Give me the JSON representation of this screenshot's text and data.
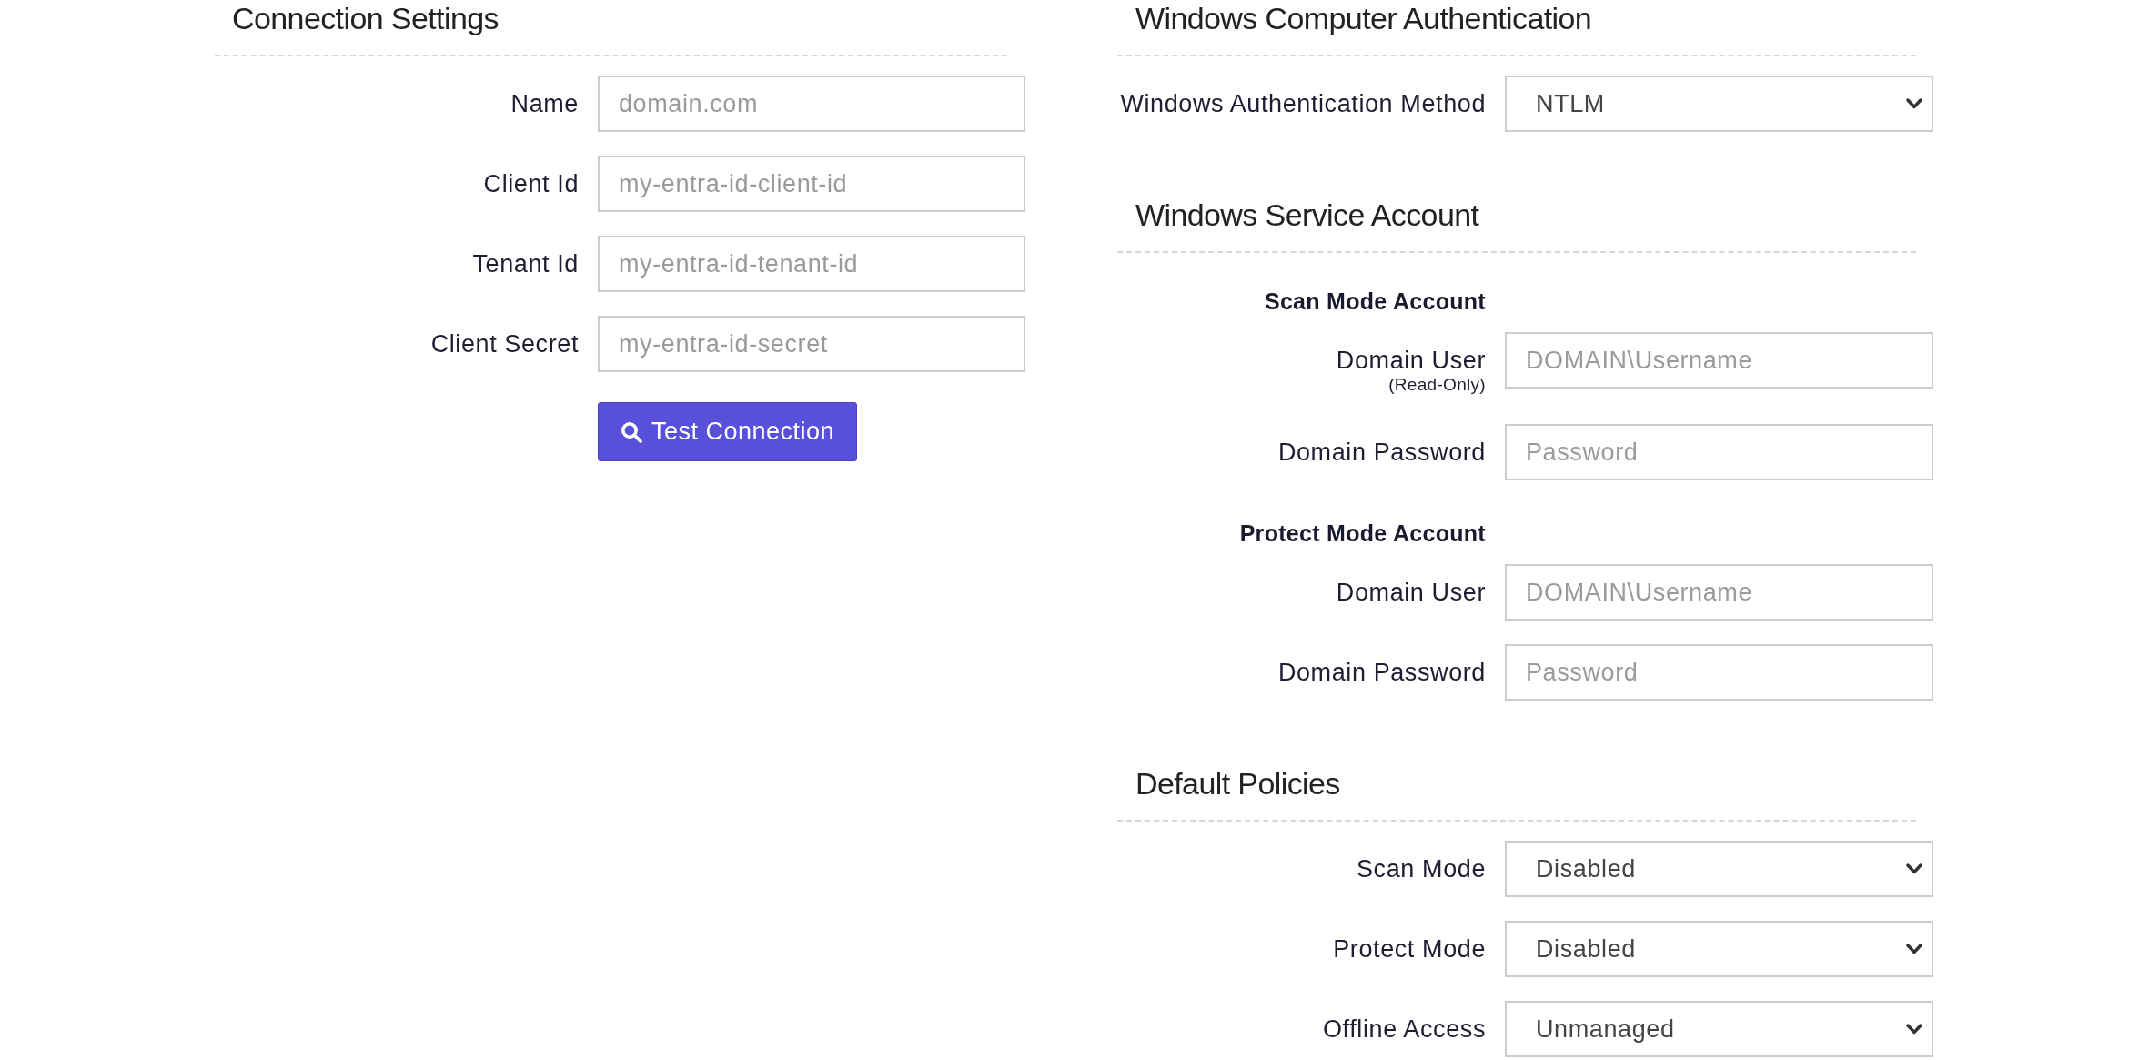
{
  "left_column": {
    "sections": [
      {
        "heading": "Connection Settings",
        "rows": [
          {
            "kind": "input",
            "label": "Name",
            "placeholder": "domain.com"
          },
          {
            "kind": "input",
            "label": "Client Id",
            "placeholder": "my-entra-id-client-id"
          },
          {
            "kind": "input",
            "label": "Tenant Id",
            "placeholder": "my-entra-id-tenant-id"
          },
          {
            "kind": "input",
            "label": "Client Secret",
            "placeholder": "my-entra-id-secret"
          },
          {
            "kind": "button",
            "label": "Test Connection"
          }
        ]
      }
    ]
  },
  "right_column": {
    "sections": [
      {
        "heading": "Windows Computer Authentication",
        "rows": [
          {
            "kind": "select",
            "label": "Windows Authentication Method",
            "value": "NTLM"
          }
        ]
      },
      {
        "heading": "Windows Service Account",
        "rows": [
          {
            "kind": "subheading",
            "label": "Scan Mode Account"
          },
          {
            "kind": "input",
            "label": "Domain User",
            "note": "(Read-Only)",
            "placeholder": "DOMAIN\\Username"
          },
          {
            "kind": "input",
            "label": "Domain Password",
            "placeholder": "Password"
          },
          {
            "kind": "subheading",
            "label": "Protect Mode Account"
          },
          {
            "kind": "input",
            "label": "Domain User",
            "placeholder": "DOMAIN\\Username"
          },
          {
            "kind": "input",
            "label": "Domain Password",
            "placeholder": "Password"
          }
        ]
      },
      {
        "heading": "Default Policies",
        "rows": [
          {
            "kind": "select",
            "label": "Scan Mode",
            "value": "Disabled"
          },
          {
            "kind": "select",
            "label": "Protect Mode",
            "value": "Disabled"
          },
          {
            "kind": "select",
            "label": "Offline Access",
            "value": "Unmanaged"
          }
        ]
      }
    ]
  }
}
